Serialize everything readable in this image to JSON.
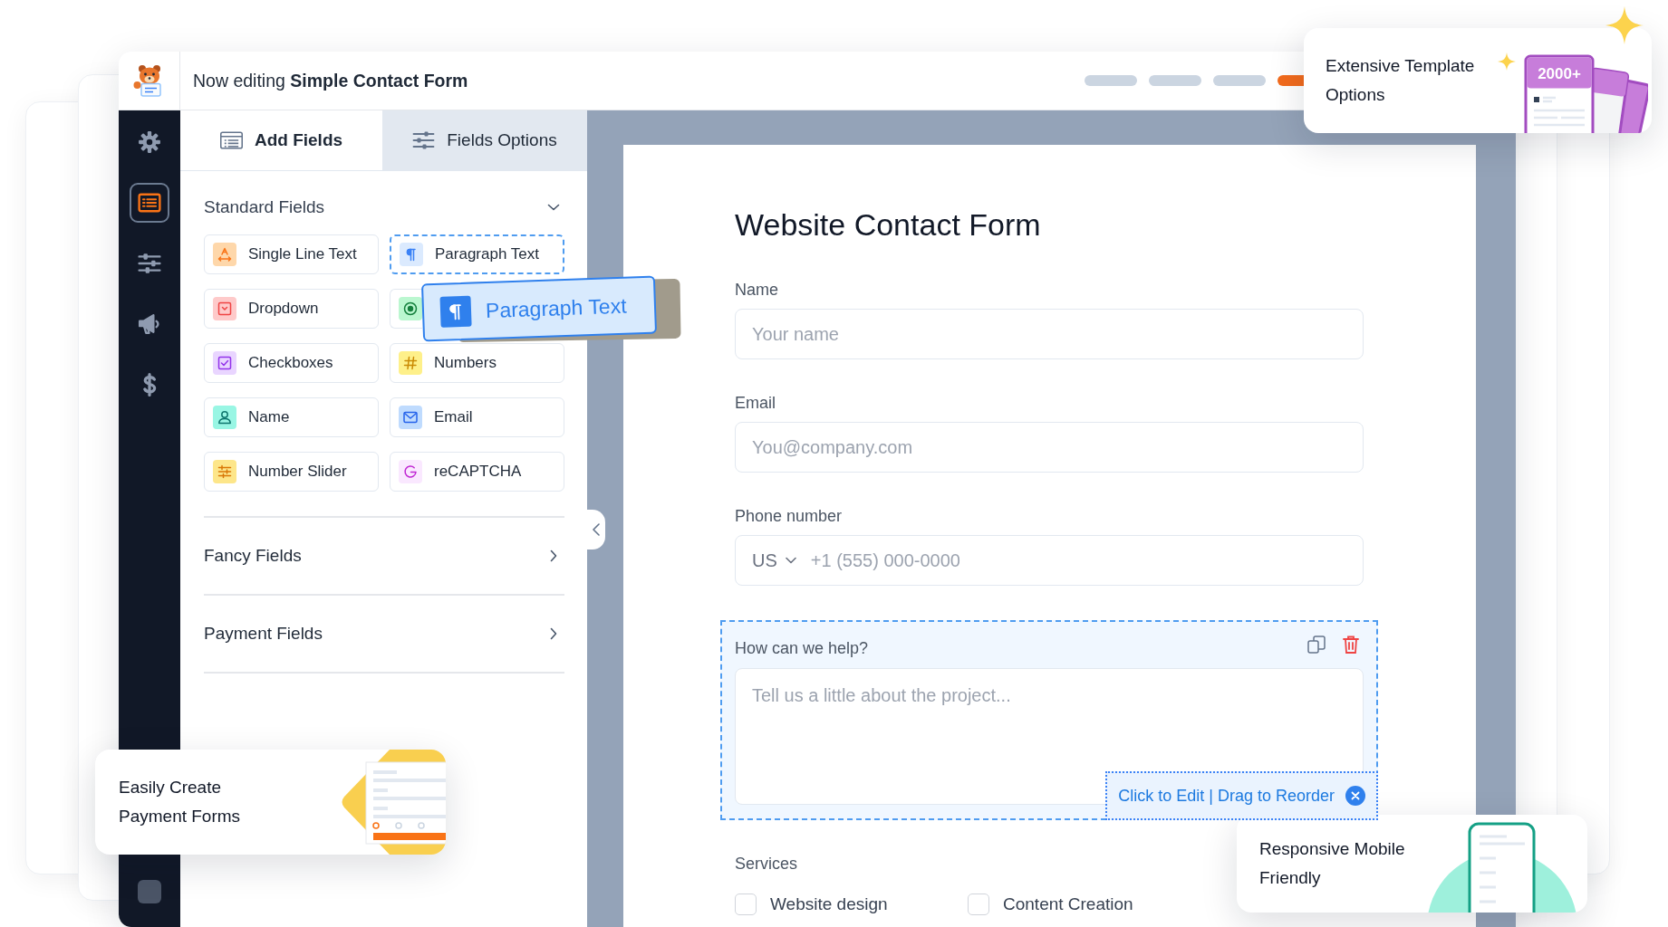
{
  "header": {
    "title": "Now editing **Simple Contact Form**",
    "steps": [
      {
        "selected": false
      },
      {
        "selected": false
      },
      {
        "selected": false
      },
      {
        "selected": true
      }
    ]
  },
  "sidebar": {
    "items": [
      {
        "selected": false
      },
      {
        "selected": true
      },
      {
        "selected": false
      },
      {
        "selected": false
      },
      {
        "selected": false
      }
    ]
  },
  "panel": {
    "tabs": [
      {
        "label": "Add Fields",
        "selected": true
      },
      {
        "label": "Fields Options",
        "selected": false
      }
    ],
    "sections": [
      {
        "title": "Standard Fields",
        "expanded": true,
        "fields": [
          {
            "label": "Single Line Text",
            "kind": "text",
            "dragging": false
          },
          {
            "label": "Paragraph Text",
            "kind": "paragraph",
            "dragging": true
          },
          {
            "label": "Dropdown",
            "kind": "dropdown",
            "dragging": false
          },
          {
            "kind": "radio",
            "dragging": false
          },
          {
            "label": "Checkboxes",
            "kind": "checkbox",
            "dragging": false
          },
          {
            "label": "Numbers",
            "kind": "number",
            "dragging": false
          },
          {
            "label": "Name",
            "kind": "name",
            "dragging": false
          },
          {
            "label": "Email",
            "kind": "email",
            "dragging": false
          },
          {
            "label": "Number Slider",
            "kind": "slider",
            "dragging": false
          },
          {
            "label": "reCAPTCHA",
            "kind": "captcha",
            "dragging": false
          }
        ]
      },
      {
        "title": "Fancy Fields",
        "expanded": false
      },
      {
        "title": "Payment Fields",
        "expanded": false
      }
    ]
  },
  "drag_ghost": {
    "label": "Paragraph Text"
  },
  "form": {
    "title": "Website Contact Form",
    "fields": [
      {
        "kind": "input",
        "label": "Name",
        "placeholder": "Your name",
        "selected": false
      },
      {
        "kind": "input",
        "label": "Email",
        "placeholder": "You@company.com",
        "selected": false
      },
      {
        "kind": "phone",
        "label": "Phone number",
        "country": "US",
        "placeholder": "+1 (555) 000-0000",
        "selected": false
      },
      {
        "kind": "textarea",
        "label": "How can we help?",
        "placeholder": "Tell us a little about the project...",
        "selected": true,
        "edit_hint": "Click to Edit | Drag to Reorder"
      },
      {
        "kind": "choices",
        "label": "Services",
        "selected": false,
        "options": [
          {
            "label": "Website design",
            "checked": false
          },
          {
            "label": "Content Creation",
            "checked": false
          }
        ]
      }
    ]
  },
  "callouts": [
    {
      "kind": "templates",
      "text": "Extensive Template Options",
      "badge": "2000+"
    },
    {
      "kind": "payments",
      "text": "Easily Create Payment Forms"
    },
    {
      "kind": "mobile",
      "text": "Responsive Mobile Friendly"
    }
  ]
}
